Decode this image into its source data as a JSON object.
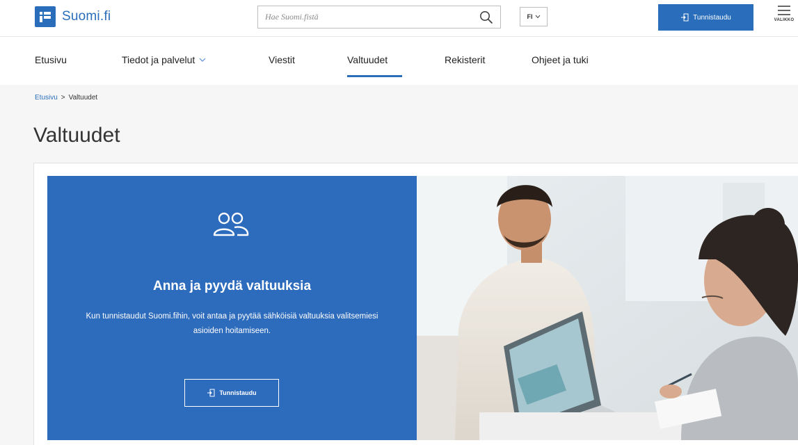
{
  "header": {
    "logo_text": "Suomi.fi",
    "search_placeholder": "Hae Suomi.fistä",
    "language": "FI",
    "login_label": "Tunnistaudu",
    "menu_label": "VALIKKO"
  },
  "nav": {
    "items": [
      {
        "label": "Etusivu"
      },
      {
        "label": "Tiedot ja palvelut"
      },
      {
        "label": "Viestit"
      },
      {
        "label": "Valtuudet"
      },
      {
        "label": "Rekisterit"
      },
      {
        "label": "Ohjeet ja tuki"
      }
    ],
    "active": "Valtuudet"
  },
  "breadcrumb": {
    "home": "Etusivu",
    "separator": ">",
    "current": "Valtuudet"
  },
  "page": {
    "title": "Valtuudet"
  },
  "hero": {
    "icon": "people-icon",
    "title": "Anna ja pyydä valtuuksia",
    "description": "Kun tunnistaudut Suomi.fihin, voit antaa ja pyytää sähköisiä valtuuksia valitsemiesi asioiden hoitamiseen.",
    "button_label": "Tunnistaudu"
  },
  "colors": {
    "brand": "#2a6ebb",
    "hero_bg": "#2d6bbd"
  }
}
